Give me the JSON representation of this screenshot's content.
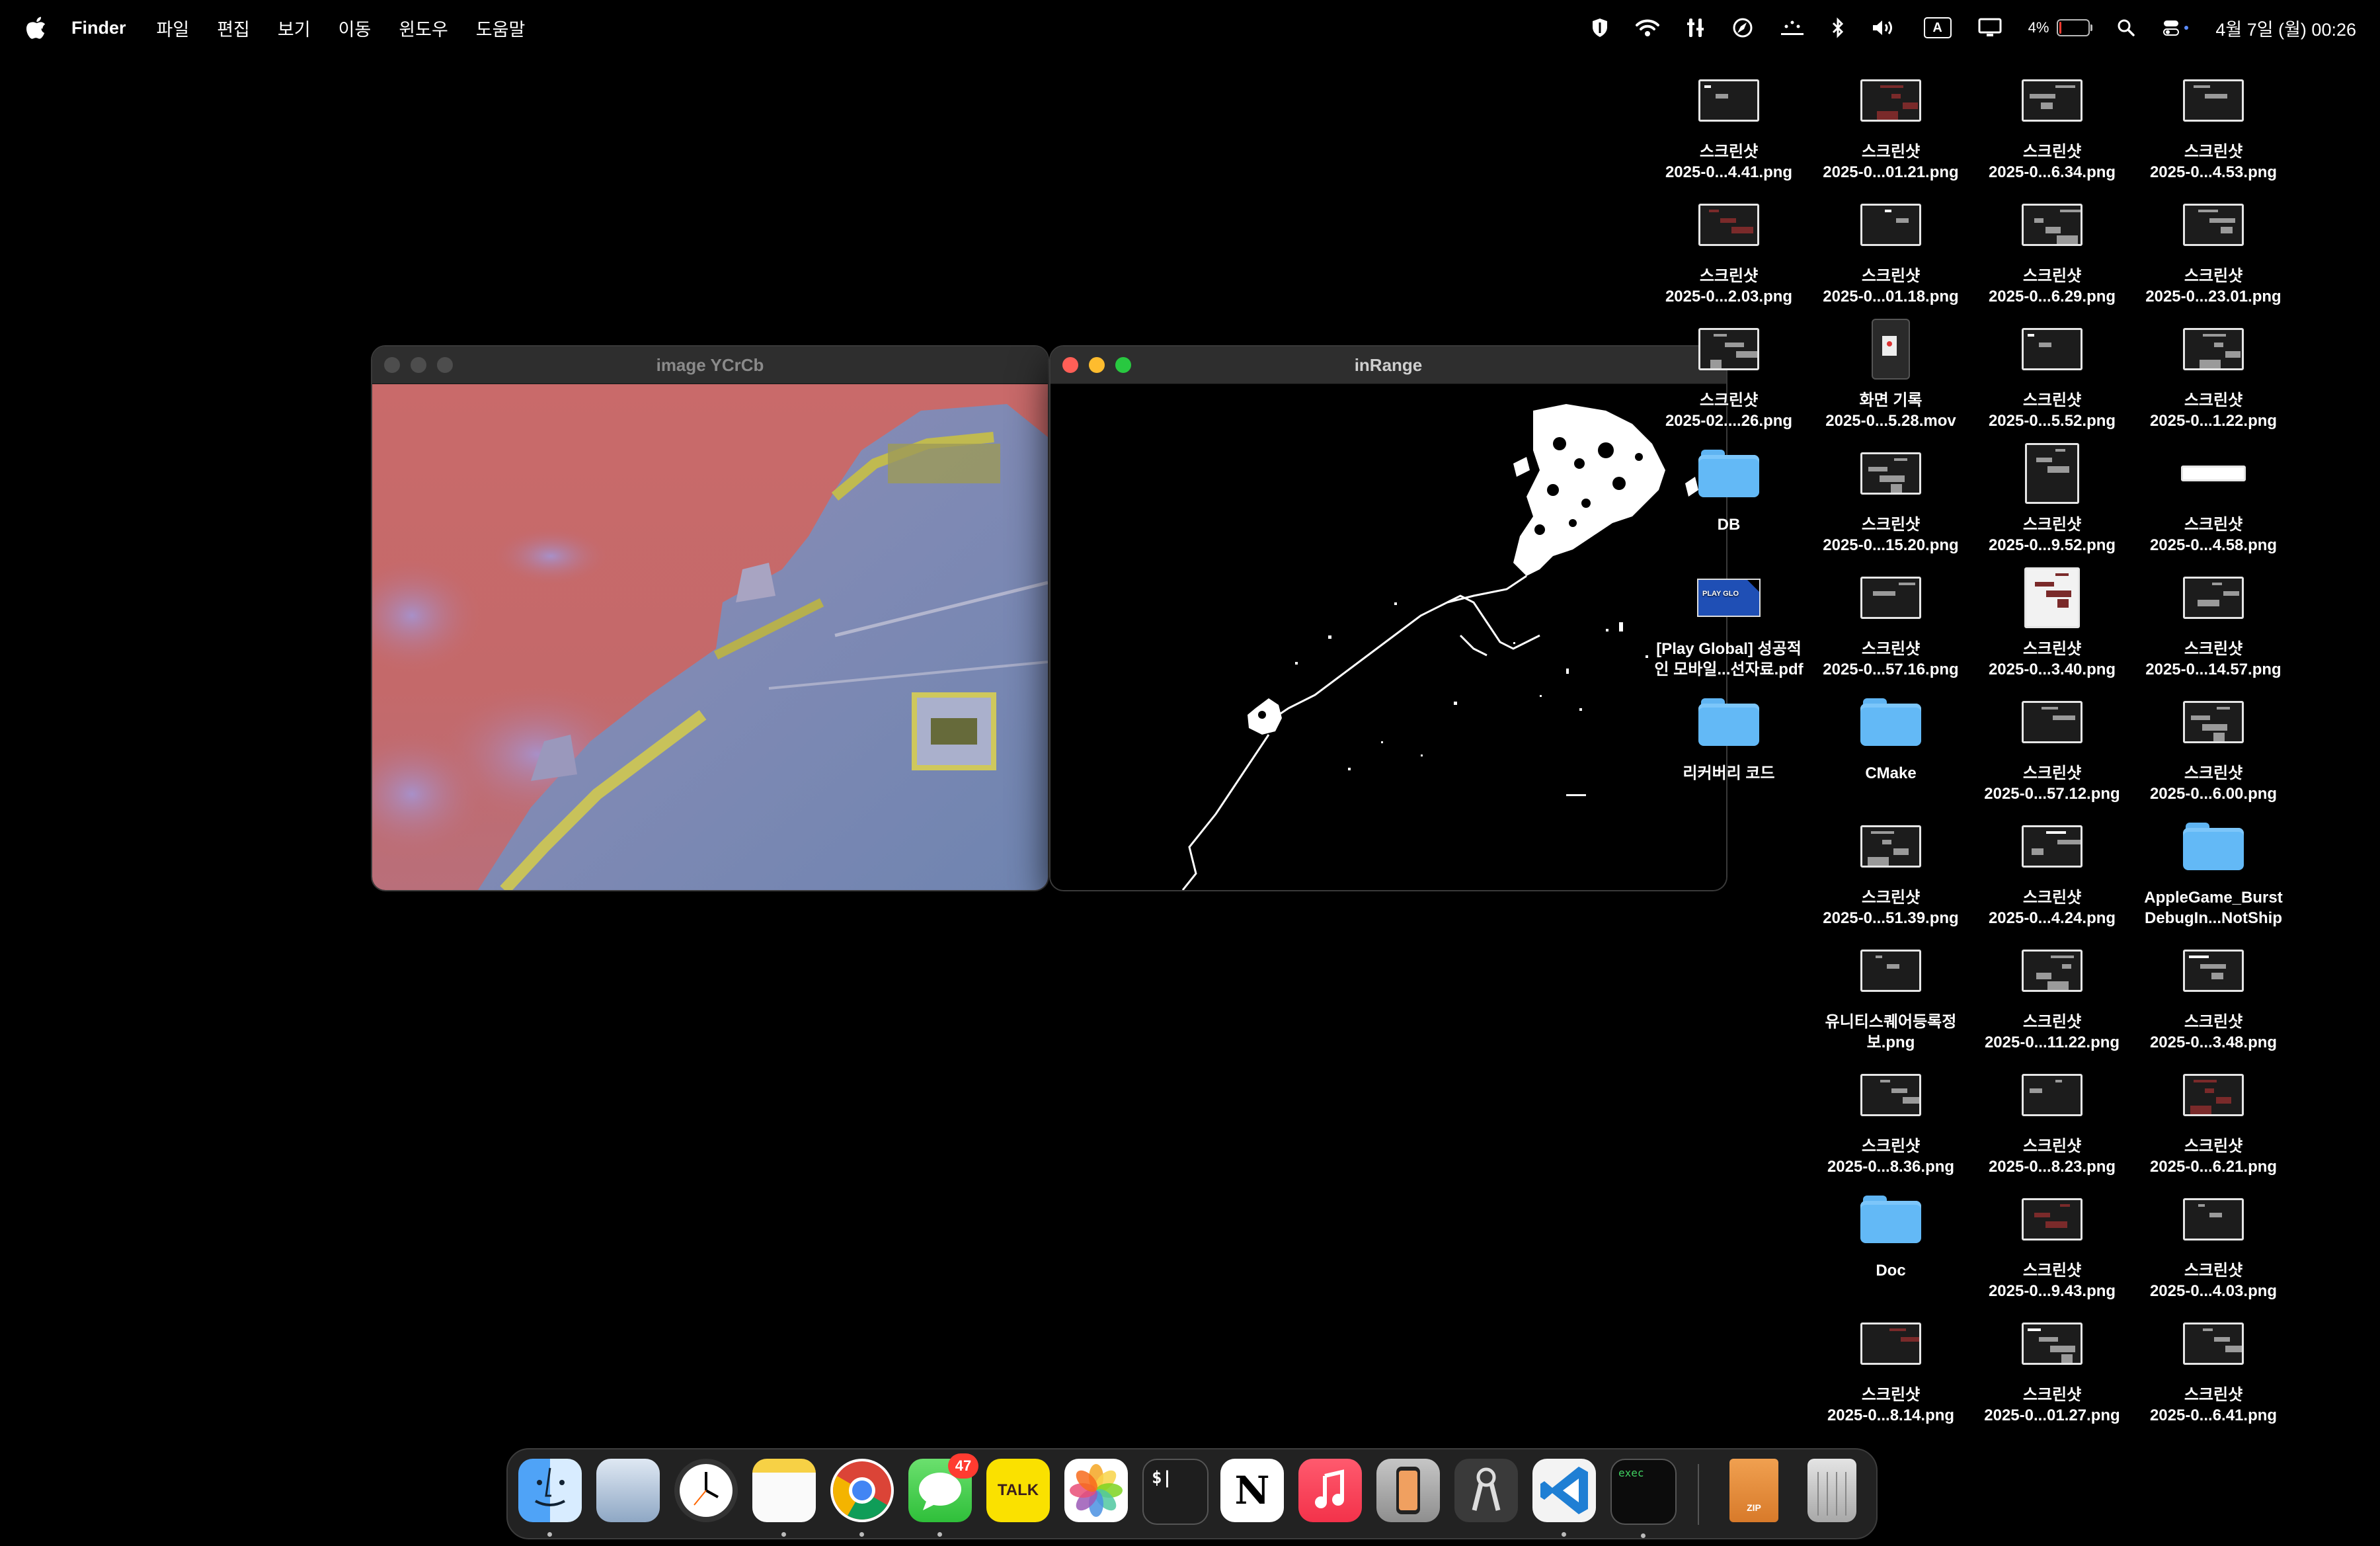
{
  "menubar": {
    "app_name": "Finder",
    "menus": [
      "파일",
      "편집",
      "보기",
      "이동",
      "윈도우",
      "도움말"
    ],
    "battery_percent": "4%",
    "battery_level": 0.04,
    "input_indicator": "A",
    "datetime": "4월 7일 (월) 00:26",
    "status_icons": [
      "shield-icon",
      "wifi-icon",
      "tools-icon",
      "compass-icon",
      "dots-icon",
      "bluetooth-icon",
      "volume-icon",
      "input-source-icon",
      "display-icon",
      "battery-icon",
      "search-icon",
      "control-center-icon"
    ]
  },
  "windows": {
    "ycrcb": {
      "title": "image YCrCb",
      "active": false
    },
    "inrange": {
      "title": "inRange",
      "active": true
    }
  },
  "desktop": {
    "columns": [
      [
        {
          "type": "screenshot",
          "line1": "스크린샷",
          "line2": "2025-0...4.41.png"
        },
        {
          "type": "screenshot",
          "line1": "스크린샷",
          "line2": "2025-0...2.03.png"
        },
        {
          "type": "screenshot",
          "line1": "스크린샷",
          "line2": "2025-02....26.png"
        },
        {
          "type": "folder",
          "line1": "DB",
          "line2": ""
        },
        {
          "type": "pdf",
          "line1": "[Play Global] 성공적",
          "line2": "인 모바일...선자료.pdf"
        },
        {
          "type": "folder",
          "line1": "리커버리 코드",
          "line2": ""
        }
      ],
      [
        {
          "type": "screenshot",
          "line1": "스크린샷",
          "line2": "2025-0...01.21.png"
        },
        {
          "type": "screenshot",
          "line1": "스크린샷",
          "line2": "2025-0...01.18.png"
        },
        {
          "type": "movie",
          "line1": "화면 기록",
          "line2": "2025-0...5.28.mov"
        },
        {
          "type": "screenshot",
          "line1": "스크린샷",
          "line2": "2025-0...15.20.png"
        },
        {
          "type": "screenshot",
          "line1": "스크린샷",
          "line2": "2025-0...57.16.png"
        },
        {
          "type": "folder",
          "line1": "CMake",
          "line2": ""
        },
        {
          "type": "screenshot",
          "line1": "스크린샷",
          "line2": "2025-0...51.39.png"
        },
        {
          "type": "screenshot",
          "line1": "유니티스퀘어등록정",
          "line2": "보.png"
        },
        {
          "type": "screenshot",
          "line1": "스크린샷",
          "line2": "2025-0...8.36.png"
        },
        {
          "type": "folder",
          "line1": "Doc",
          "line2": ""
        },
        {
          "type": "screenshot",
          "line1": "스크린샷",
          "line2": "2025-0...8.14.png"
        }
      ],
      [
        {
          "type": "screenshot",
          "line1": "스크린샷",
          "line2": "2025-0...6.34.png"
        },
        {
          "type": "screenshot",
          "line1": "스크린샷",
          "line2": "2025-0...6.29.png"
        },
        {
          "type": "screenshot",
          "line1": "스크린샷",
          "line2": "2025-0...5.52.png"
        },
        {
          "type": "screenshot-tall",
          "line1": "스크린샷",
          "line2": "2025-0...9.52.png"
        },
        {
          "type": "screenshot-doc",
          "line1": "스크린샷",
          "line2": "2025-0...3.40.png"
        },
        {
          "type": "screenshot",
          "line1": "스크린샷",
          "line2": "2025-0...57.12.png"
        },
        {
          "type": "screenshot",
          "line1": "스크린샷",
          "line2": "2025-0...4.24.png"
        },
        {
          "type": "screenshot",
          "line1": "스크린샷",
          "line2": "2025-0...11.22.png"
        },
        {
          "type": "screenshot",
          "line1": "스크린샷",
          "line2": "2025-0...8.23.png"
        },
        {
          "type": "screenshot",
          "line1": "스크린샷",
          "line2": "2025-0...9.43.png"
        },
        {
          "type": "screenshot",
          "line1": "스크린샷",
          "line2": "2025-0...01.27.png"
        }
      ],
      [
        {
          "type": "screenshot",
          "line1": "스크린샷",
          "line2": "2025-0...4.53.png"
        },
        {
          "type": "screenshot",
          "line1": "스크린샷",
          "line2": "2025-0...23.01.png"
        },
        {
          "type": "screenshot",
          "line1": "스크린샷",
          "line2": "2025-0...1.22.png"
        },
        {
          "type": "screenshot-wide",
          "line1": "스크린샷",
          "line2": "2025-0...4.58.png"
        },
        {
          "type": "screenshot",
          "line1": "스크린샷",
          "line2": "2025-0...14.57.png"
        },
        {
          "type": "screenshot",
          "line1": "스크린샷",
          "line2": "2025-0...6.00.png"
        },
        {
          "type": "folder",
          "line1": "AppleGame_Burst",
          "line2": "DebugIn...NotShip"
        },
        {
          "type": "screenshot",
          "line1": "스크린샷",
          "line2": "2025-0...3.48.png"
        },
        {
          "type": "screenshot",
          "line1": "스크린샷",
          "line2": "2025-0...6.21.png"
        },
        {
          "type": "screenshot",
          "line1": "스크린샷",
          "line2": "2025-0...4.03.png"
        },
        {
          "type": "screenshot",
          "line1": "스크린샷",
          "line2": "2025-0...6.41.png"
        }
      ]
    ]
  },
  "dock": {
    "apps": [
      {
        "name": "finder-icon",
        "running": true
      },
      {
        "name": "preview-icon",
        "running": false
      },
      {
        "name": "clock-icon",
        "running": false
      },
      {
        "name": "notes-icon",
        "running": true
      },
      {
        "name": "chrome-icon",
        "running": true
      },
      {
        "name": "messages-icon",
        "running": true,
        "badge": "47"
      },
      {
        "name": "kakaotalk-icon",
        "running": false,
        "text": "TALK"
      },
      {
        "name": "photos-icon",
        "running": false
      },
      {
        "name": "terminal-icon",
        "running": false,
        "text": "$|"
      },
      {
        "name": "notion-icon",
        "running": false,
        "text": "N"
      },
      {
        "name": "music-icon",
        "running": false
      },
      {
        "name": "iphone-mirroring-icon",
        "running": false
      },
      {
        "name": "keychain-icon",
        "running": false
      },
      {
        "name": "vscode-icon",
        "running": true
      },
      {
        "name": "exec-icon",
        "running": true,
        "text": "exec"
      },
      {
        "name": "archive-icon",
        "running": false,
        "text": "ZIP"
      },
      {
        "name": "trash-icon",
        "running": false
      }
    ]
  }
}
